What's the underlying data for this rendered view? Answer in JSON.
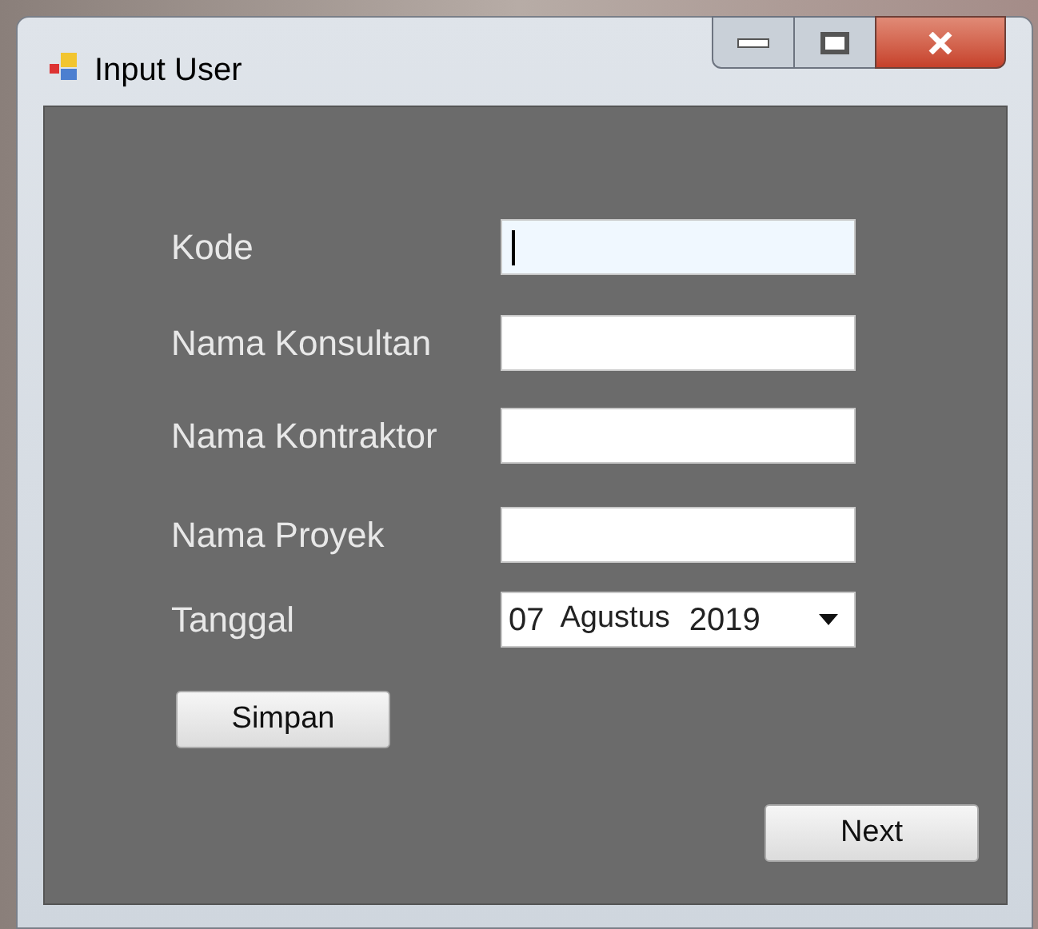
{
  "window": {
    "title": "Input User"
  },
  "fields": [
    {
      "label": "Kode",
      "kind": "text",
      "focused": true
    },
    {
      "label": "Nama Konsultan",
      "kind": "text",
      "focused": false
    },
    {
      "label": "Nama Kontraktor",
      "kind": "text",
      "focused": false
    },
    {
      "label": "Nama Proyek",
      "kind": "text",
      "focused": false
    },
    {
      "label": "Tanggal",
      "kind": "date",
      "focused": false,
      "day": "07",
      "month": "Agustus",
      "year": "2019"
    }
  ],
  "buttons": [
    {
      "label": "Simpan",
      "kind": "save"
    },
    {
      "label": "Next",
      "kind": "next"
    }
  ]
}
